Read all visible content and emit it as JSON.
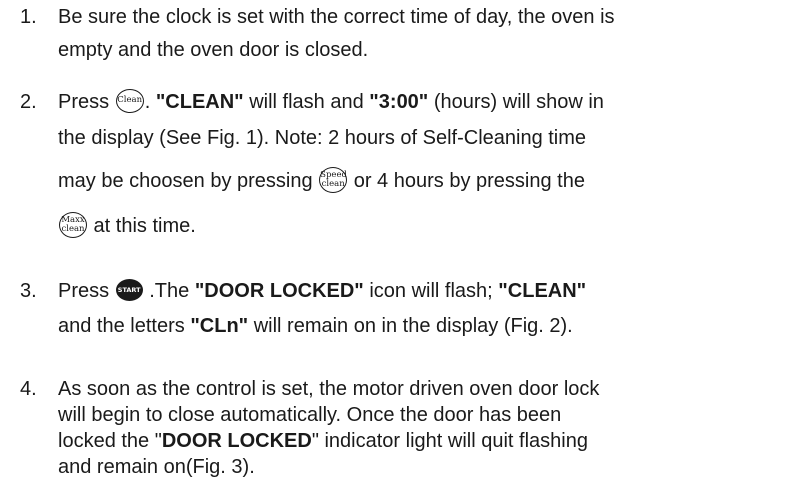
{
  "steps": [
    {
      "number": "1.",
      "line1": "Be sure the clock is set with the correct time of day, the oven is",
      "line2": "empty and the oven door is closed."
    },
    {
      "number": "2.",
      "press": "Press ",
      "key_clean": "Clean",
      "after_key": ". ",
      "clean_word": "\"CLEAN\"",
      "flash_and": " will flash and ",
      "hours_value": "\"3:00\"",
      "hours_rest": " (hours) will show in",
      "line2": "the display (See Fig. 1). Note: 2 hours of Self-Cleaning time",
      "line3_pre": "may be choosen by pressing ",
      "key_speed_top": "Speed",
      "key_speed_bottom": "clean",
      "line3_post": " or 4 hours by pressing the",
      "key_maxx_top": "Maxx",
      "key_maxx_bottom": "clean",
      "line4_post": " at this time."
    },
    {
      "number": "3.",
      "press": "Press ",
      "key_start": "START",
      "after_key": " .The ",
      "door_locked": "\"DOOR LOCKED\"",
      "icon_flash": " icon will flash; ",
      "clean_word": "\"CLEAN\"",
      "line2_pre": "and the letters ",
      "cln": "\"CLn\"",
      "line2_post": " will remain on in the display (Fig. 2)."
    },
    {
      "number": "4.",
      "line1": "As soon as the control is set, the motor driven oven door lock",
      "line2": "will begin to close automatically. Once the door has been",
      "line3_pre": "locked the \"",
      "door_locked": "DOOR LOCKED",
      "line3_post": "\" indicator light will quit flashing",
      "line4": "and remain on(Fig. 3)."
    }
  ]
}
